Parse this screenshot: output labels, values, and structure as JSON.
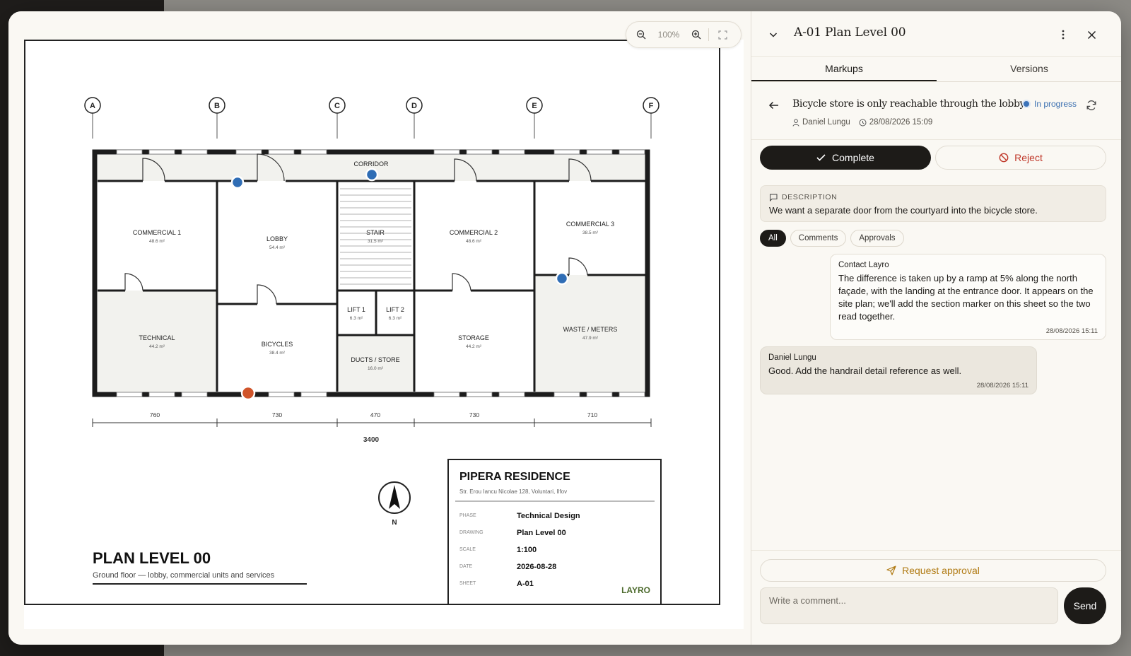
{
  "header": {
    "title": "A-01 Plan Level 00"
  },
  "viewer": {
    "zoom": "100%"
  },
  "tabs": [
    "Markups",
    "Versions"
  ],
  "markup": {
    "title": "Bicycle store is only reachable through the lobby",
    "status": "In progress",
    "author": "Daniel Lungu",
    "created": "28/08/2026 15:09"
  },
  "actions": {
    "complete": "Complete",
    "reject": "Reject"
  },
  "description": {
    "label": "DESCRIPTION",
    "text": "We want a separate door from the courtyard into the bicycle store."
  },
  "filters": [
    "All",
    "Comments",
    "Approvals"
  ],
  "messages": [
    {
      "author": "Contact Layro",
      "text": "The difference is taken up by a ramp at 5% along the north façade, with the landing at the entrance door. It appears on the site plan; we'll add the section marker on this sheet so the two read together.",
      "time": "28/08/2026 15:11"
    },
    {
      "author": "Daniel Lungu",
      "text": "Good. Add the handrail detail reference as well.",
      "time": "28/08/2026 15:11"
    }
  ],
  "footer": {
    "request_approval": "Request approval",
    "comment_placeholder": "Write a comment...",
    "send": "Send"
  },
  "drawing": {
    "grid": [
      "A",
      "B",
      "C",
      "D",
      "E",
      "F"
    ],
    "rooms": [
      {
        "name": "CORRIDOR",
        "area": ""
      },
      {
        "name": "COMMERCIAL 1",
        "area": "48.6 m²"
      },
      {
        "name": "LOBBY",
        "area": "54.4 m²"
      },
      {
        "name": "STAIR",
        "area": "31.5 m²"
      },
      {
        "name": "COMMERCIAL 2",
        "area": "48.6 m²"
      },
      {
        "name": "COMMERCIAL 3",
        "area": "38.5 m²"
      },
      {
        "name": "TECHNICAL",
        "area": "44.2 m²"
      },
      {
        "name": "BICYCLES",
        "area": "38.4 m²"
      },
      {
        "name": "LIFT 1",
        "area": "6.3 m²"
      },
      {
        "name": "LIFT 2",
        "area": "6.3 m²"
      },
      {
        "name": "DUCTS / STORE",
        "area": "16.0 m²"
      },
      {
        "name": "STORAGE",
        "area": "44.2 m²"
      },
      {
        "name": "WASTE / METERS",
        "area": "47.9 m²"
      }
    ],
    "dimensions": [
      "760",
      "730",
      "470",
      "730",
      "710"
    ],
    "total_dimension": "3400",
    "north": "N",
    "plan_title": "PLAN LEVEL 00",
    "plan_subtitle": "Ground floor — lobby, commercial units and services",
    "title_block": {
      "project": "PIPERA RESIDENCE",
      "address": "Str. Erou Iancu Nicolae 128, Voluntari, Ilfov",
      "rows": [
        {
          "label": "PHASE",
          "value": "Technical Design"
        },
        {
          "label": "DRAWING",
          "value": "Plan Level 00"
        },
        {
          "label": "SCALE",
          "value": "1:100"
        },
        {
          "label": "DATE",
          "value": "2026-08-28"
        },
        {
          "label": "SHEET",
          "value": "A-01"
        }
      ],
      "brand": "LAYRO"
    }
  },
  "colors": {
    "pin_blue": "#2f6db5",
    "pin_orange": "#d0542a",
    "accent_approval": "#b07a12",
    "reject": "#c0392b"
  }
}
